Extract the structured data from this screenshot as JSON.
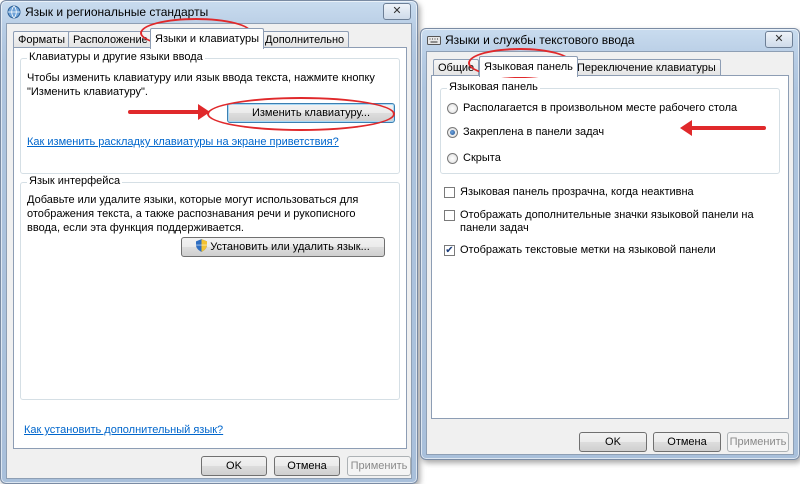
{
  "left_window": {
    "title": "Язык и региональные стандарты",
    "close_label": "✕",
    "tabs": [
      "Форматы",
      "Расположение",
      "Языки и клавиатуры",
      "Дополнительно"
    ],
    "keyboards_group": {
      "title": "Клавиатуры и другие языки ввода",
      "text_line1": "Чтобы изменить клавиатуру или язык ввода текста, нажмите кнопку",
      "text_line2": "\"Изменить клавиатуру\".",
      "change_button": "Изменить клавиатуру...",
      "link": "Как изменить раскладку клавиатуры на экране приветствия?"
    },
    "ui_language_group": {
      "title": "Язык интерфейса",
      "text_line1": "Добавьте или удалите языки, которые могут использоваться для",
      "text_line2": "отображения текста, а также распознавания речи и рукописного",
      "text_line3": "ввода, если эта функция поддерживается.",
      "install_button": "Установить или удалить язык..."
    },
    "bottom_link": "Как установить дополнительный язык?",
    "ok": "OK",
    "cancel": "Отмена",
    "apply": "Применить"
  },
  "right_window": {
    "title": "Языки и службы текстового ввода",
    "close_label": "✕",
    "tabs": [
      "Общие",
      "Языковая панель",
      "Переключение клавиатуры"
    ],
    "language_bar_group": {
      "title": "Языковая панель",
      "options": [
        {
          "label": "Располагается в произвольном месте рабочего стола",
          "selected": false
        },
        {
          "label": "Закреплена в панели задач",
          "selected": true
        },
        {
          "label": "Скрыта",
          "selected": false
        }
      ]
    },
    "checkboxes": [
      {
        "label": "Языковая панель прозрачна, когда неактивна",
        "checked": false
      },
      {
        "label_line1": "Отображать дополнительные значки языковой панели на",
        "label_line2": "панели задач",
        "checked": false
      },
      {
        "label": "Отображать текстовые метки на языковой панели",
        "checked": true
      }
    ],
    "ok": "OK",
    "cancel": "Отмена",
    "apply": "Применить"
  },
  "annotation_color": "#e0292b"
}
